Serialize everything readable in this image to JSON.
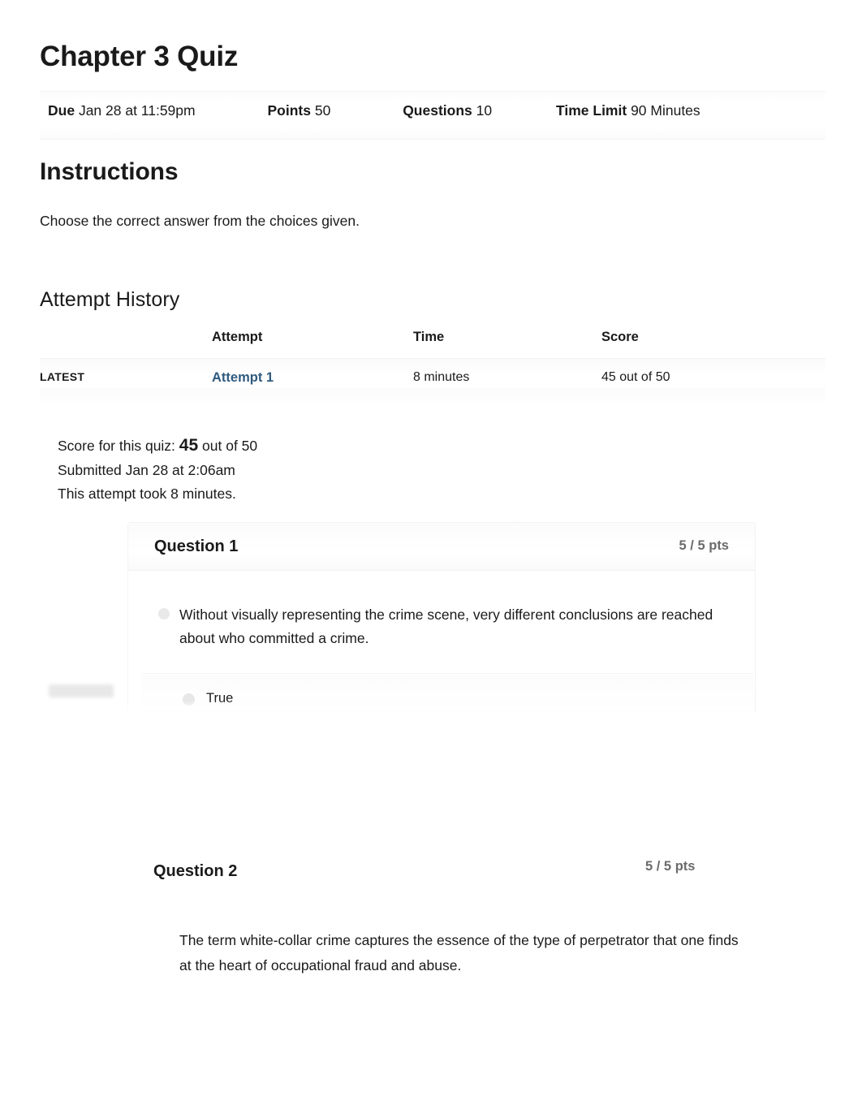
{
  "quiz": {
    "title": "Chapter 3 Quiz",
    "meta": [
      {
        "label": "Due",
        "value": "Jan 28 at 11:59pm"
      },
      {
        "label": "Points",
        "value": "50"
      },
      {
        "label": "Questions",
        "value": "10"
      },
      {
        "label": "Time Limit",
        "value": "90 Minutes"
      }
    ]
  },
  "instructions": {
    "heading": "Instructions",
    "body": "Choose the correct answer from the choices given."
  },
  "attempt_history": {
    "heading": "Attempt History",
    "columns": [
      "",
      "Attempt",
      "Time",
      "Score"
    ],
    "rows": [
      {
        "kept": "LATEST",
        "attempt": "Attempt 1",
        "time": "8 minutes",
        "score": "45 out of 50"
      }
    ]
  },
  "score_summary": {
    "score_prefix": "Score for this quiz:",
    "score_value": "45",
    "score_suffix": "out of 50",
    "submitted": "Submitted Jan 28 at 2:06am",
    "duration": "This attempt took 8 minutes."
  },
  "questions": [
    {
      "name": "Question 1",
      "points": "5 / 5 pts",
      "text": "Without visually representing the crime scene, very different conclusions are reached about who committed a crime.",
      "answers": [
        {
          "label": "True"
        }
      ]
    },
    {
      "name": "Question 2",
      "points": "5 / 5 pts",
      "text": "The term white-collar crime captures the essence of the type of perpetrator that one finds at the heart of occupational fraud and abuse.",
      "answers": []
    }
  ],
  "colors": {
    "link": "#2f5a7e",
    "text": "#1a1a1a",
    "muted": "#6b6b6b",
    "border": "#f2f2f3"
  }
}
